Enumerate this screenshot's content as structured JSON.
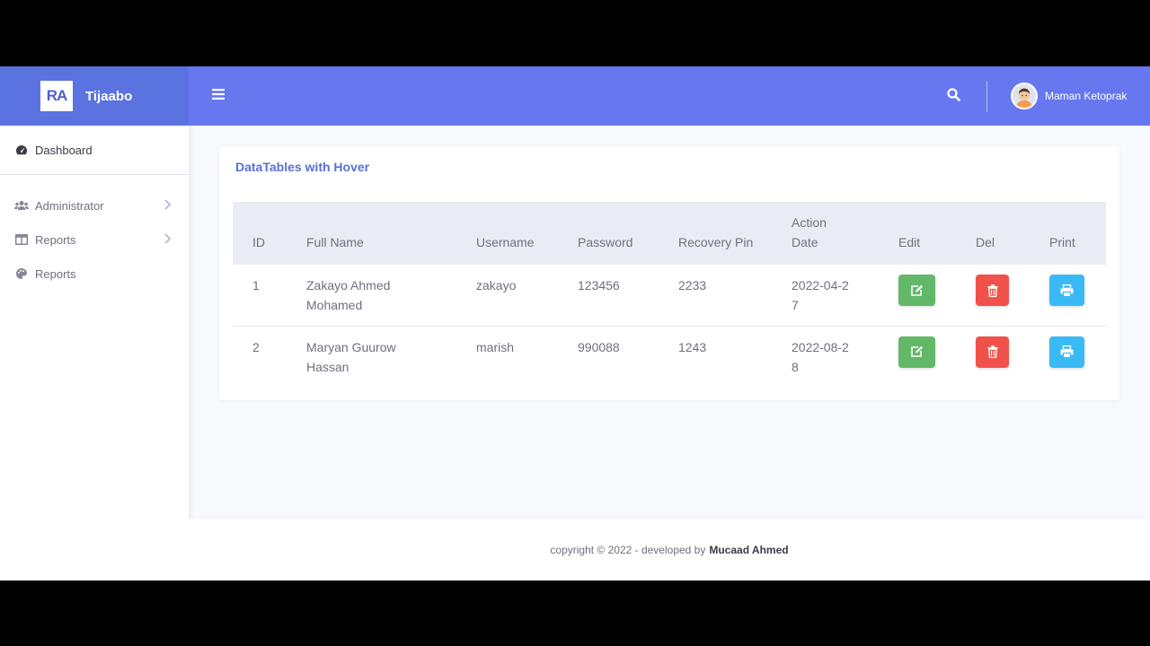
{
  "brand": {
    "logo_text": "RA",
    "name": "Tijaabo"
  },
  "sidebar": {
    "items": [
      {
        "label": "Dashboard",
        "icon": "tachometer-icon"
      },
      {
        "label": "Administrator",
        "icon": "users-icon"
      },
      {
        "label": "Reports",
        "icon": "table-icon"
      },
      {
        "label": "Reports",
        "icon": "palette-icon"
      }
    ]
  },
  "topbar": {
    "user_name": "Maman Ketoprak"
  },
  "card": {
    "title": "DataTables with Hover",
    "columns": [
      "ID",
      "Full Name",
      "Username",
      "Password",
      "Recovery Pin",
      "Action Date",
      "Edit",
      "Del",
      "Print"
    ],
    "rows": [
      {
        "id": "1",
        "full_name": "Zakayo Ahmed Mohamed",
        "username": "zakayo",
        "password": "123456",
        "pin": "2233",
        "date": "2022-04-27"
      },
      {
        "id": "2",
        "full_name": "Maryan Guurow Hassan",
        "username": "marish",
        "password": "990088",
        "pin": "1243",
        "date": "2022-08-28"
      }
    ]
  },
  "footer": {
    "text": "copyright © 2022 - developed by",
    "author": "Mucaad Ahmed"
  },
  "colors": {
    "topbar": "#6777ef",
    "brand": "#5a73e0",
    "edit": "#63b867",
    "delete": "#f0524b",
    "print": "#3abaf4"
  }
}
